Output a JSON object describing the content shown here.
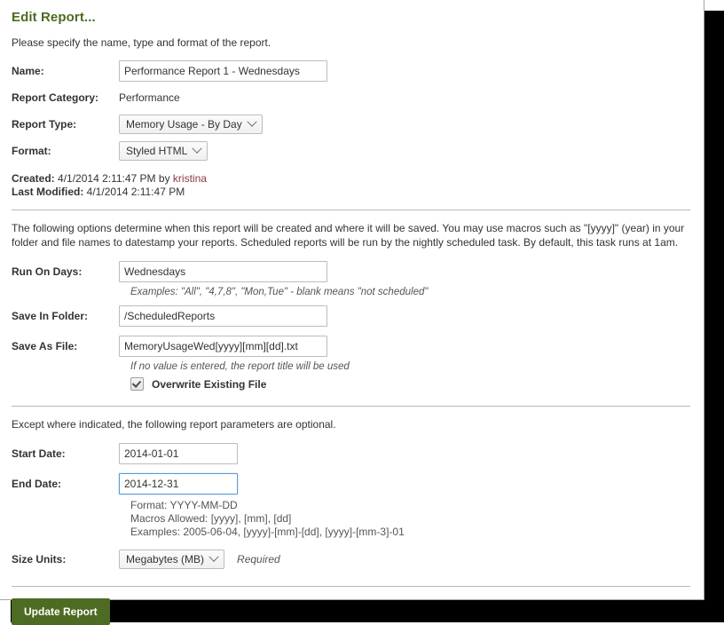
{
  "window": {
    "title": "Edit Report..."
  },
  "intro": {
    "text": "Please specify the name, type and format of the report."
  },
  "details": {
    "name_label": "Name:",
    "name_value": "Performance Report 1 - Wednesdays",
    "name_placeholder": "",
    "category_label": "Report Category:",
    "category_value": "Performance",
    "type_label": "Report Type:",
    "type_value": "Memory Usage - By Day",
    "format_label": "Format:",
    "format_value": "Styled HTML"
  },
  "meta": {
    "created_label": "Created:",
    "created_value": "4/1/2014 2:11:47 PM by",
    "created_user": "kristina",
    "modified_label": "Last Modified:",
    "modified_value": "4/1/2014 2:11:47 PM"
  },
  "schedule": {
    "description": "The following options determine when this report will be created and where it will be saved. You may use macros such as \"[yyyy]\" (year) in your folder and file names to datestamp your reports. Scheduled reports will be run by the nightly scheduled task. By default, this task runs at 1am.",
    "run_on_days_label": "Run On Days:",
    "run_on_days_value": "Wednesdays",
    "run_on_days_hint": "Examples: \"All\", \"4,7,8\", \"Mon,Tue\" - blank means \"not scheduled\"",
    "save_in_folder_label": "Save In Folder:",
    "save_in_folder_value": "/ScheduledReports",
    "save_as_file_label": "Save As File:",
    "save_as_file_value": "MemoryUsageWed[yyyy][mm][dd].txt",
    "save_as_file_hint": "If no value is entered, the report title will be used",
    "overwrite_label": "Overwrite Existing File"
  },
  "parameters": {
    "description": "Except where indicated, the following report parameters are optional.",
    "start_date_label": "Start Date:",
    "start_date_value": "2014-01-01",
    "end_date_label": "End Date:",
    "end_date_value": "2014-12-31",
    "date_hint_format": "Format: YYYY-MM-DD",
    "date_hint_macros": "Macros Allowed: [yyyy], [mm], [dd]",
    "date_hint_examples": "Examples: 2005-06-04, [yyyy]-[mm]-[dd], [yyyy]-[mm-3]-01",
    "size_units_label": "Size Units:",
    "size_units_value": "Megabytes (MB)",
    "size_units_required": "Required"
  },
  "actions": {
    "submit_label": "Update Report"
  },
  "colors": {
    "title_green": "#4b6b20",
    "button_green": "#4d6b22",
    "link_maroon": "#8a3a3a",
    "focus_blue": "#5b9bd5"
  }
}
